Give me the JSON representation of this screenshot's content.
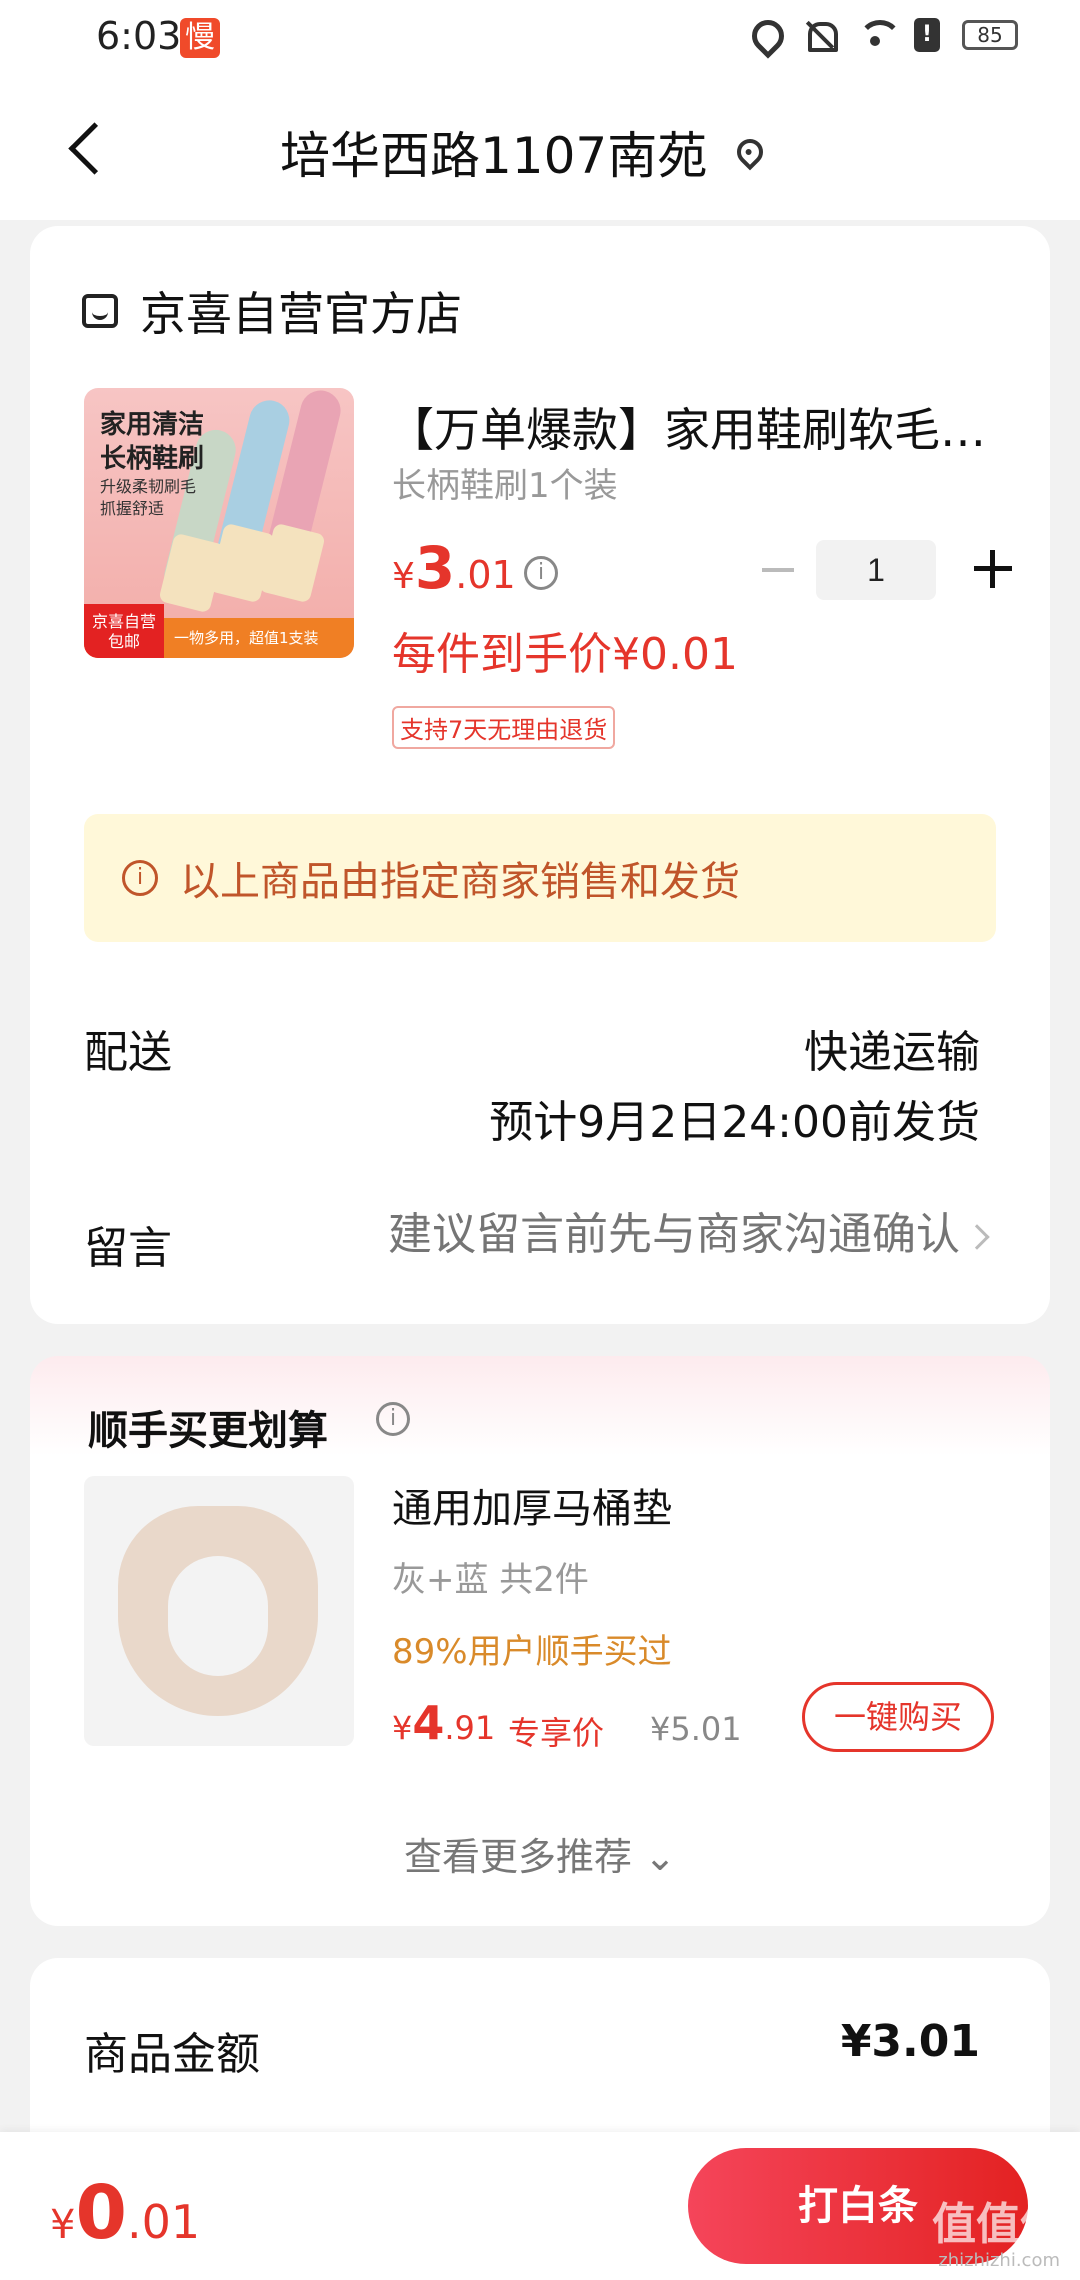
{
  "status_bar": {
    "time": "6:03",
    "app_badge": "慢",
    "battery": "85"
  },
  "header": {
    "title": "培华西路1107南苑"
  },
  "store": {
    "name": "京喜自营官方店"
  },
  "product": {
    "image_text_1": "家用清洁\n长柄鞋刷",
    "image_text_2": "升级柔韧刷毛\n抓握舒适",
    "image_badge_left": "京喜自营\n包邮",
    "image_badge_right": "一物多用，超值1支装",
    "title": "【万单爆款】家用鞋刷软毛不伤鞋",
    "spec": "长柄鞋刷1个装",
    "price_currency": "¥",
    "price_int": "3",
    "price_dec": ".01",
    "quantity": "1",
    "unit_price": "每件到手价¥0.01",
    "return_tag": "支持7天无理由退货"
  },
  "notice": {
    "text": "以上商品由指定商家销售和发货"
  },
  "delivery": {
    "label": "配送",
    "method": "快递运输",
    "eta": "预计9月2日24:00前发货"
  },
  "message": {
    "label": "留言",
    "placeholder": "建议留言前先与商家沟通确认"
  },
  "upsell": {
    "title": "顺手买更划算",
    "name": "通用加厚马桶垫",
    "spec": "灰+蓝 共2件",
    "stat": "89%用户顺手买过",
    "price_currency": "¥",
    "price_int": "4",
    "price_dec": ".91",
    "exclusive": "专享价",
    "original": "¥5.01",
    "buy_label": "一键购买",
    "more_label": "查看更多推荐 ⌄"
  },
  "summary": {
    "label": "商品金额",
    "value": "¥3.01"
  },
  "bottom": {
    "total_currency": "¥",
    "total_int": "0",
    "total_dec": ".01",
    "pay_label": "打白条",
    "watermark": "值值值",
    "watermark_sub": "zhizhizhi.com"
  },
  "colors": {
    "accent": "#e5352b",
    "notice_bg": "#fff8d9",
    "notice_text": "#c0552a",
    "stat": "#d98a2a"
  }
}
